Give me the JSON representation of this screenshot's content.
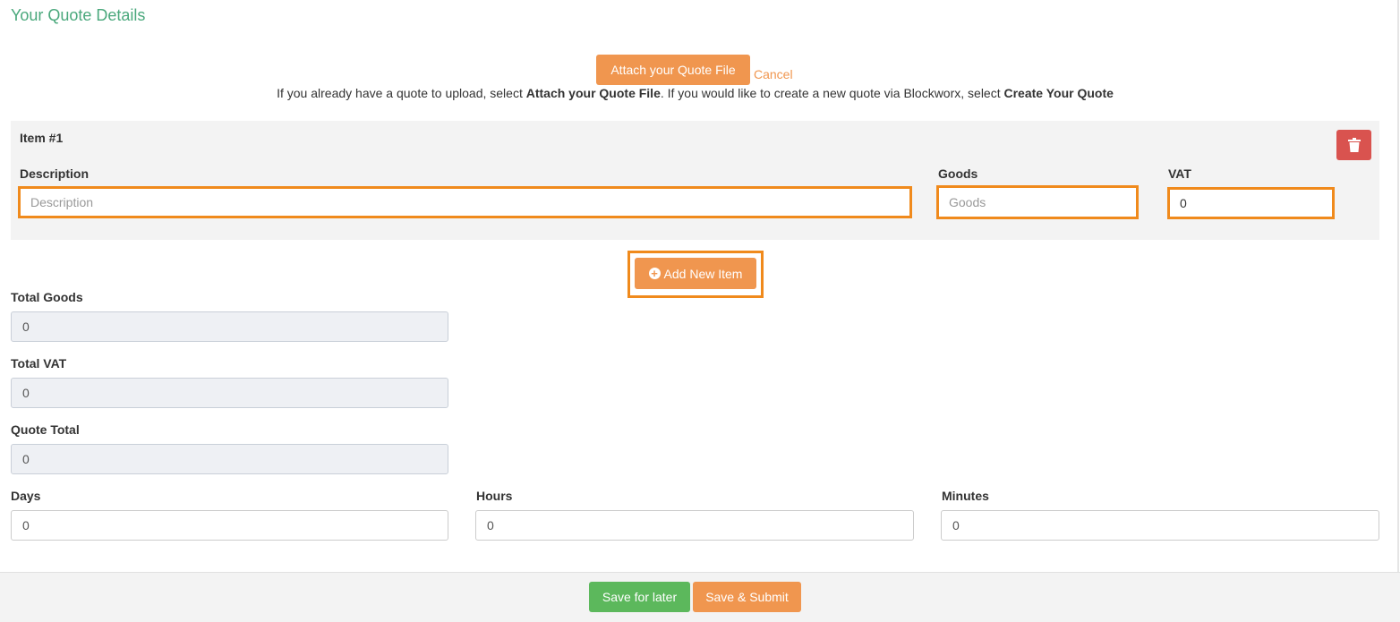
{
  "page": {
    "title": "Your Quote Details"
  },
  "attach": {
    "button_label": "Attach your Quote File",
    "cancel_label": "Cancel",
    "hint_pre": "If you already have a quote to upload, select ",
    "hint_attach": "Attach your Quote File",
    "hint_mid": ". If you would like to create a new quote via Blockworx, select ",
    "hint_create": "Create Your Quote"
  },
  "item": {
    "heading": "Item #1",
    "delete_icon": "trash-icon",
    "description": {
      "label": "Description",
      "placeholder": "Description",
      "value": ""
    },
    "goods": {
      "label": "Goods",
      "placeholder": "Goods",
      "value": ""
    },
    "vat": {
      "label": "VAT",
      "value": "0"
    }
  },
  "add_item": {
    "label": "Add New Item",
    "icon": "plus-circle-icon"
  },
  "totals": {
    "goods": {
      "label": "Total Goods",
      "value": "0"
    },
    "vat": {
      "label": "Total VAT",
      "value": "0"
    },
    "quote": {
      "label": "Quote Total",
      "value": "0"
    }
  },
  "duration": {
    "days": {
      "label": "Days",
      "value": "0"
    },
    "hours": {
      "label": "Hours",
      "value": "0"
    },
    "minutes": {
      "label": "Minutes",
      "value": "0"
    }
  },
  "footer": {
    "save_later": "Save for later",
    "save_submit": "Save & Submit"
  },
  "colors": {
    "title": "#4aa87c",
    "accent": "#f0964f",
    "highlight": "#f08a1c",
    "success": "#5cb85c",
    "danger": "#d9534f"
  }
}
